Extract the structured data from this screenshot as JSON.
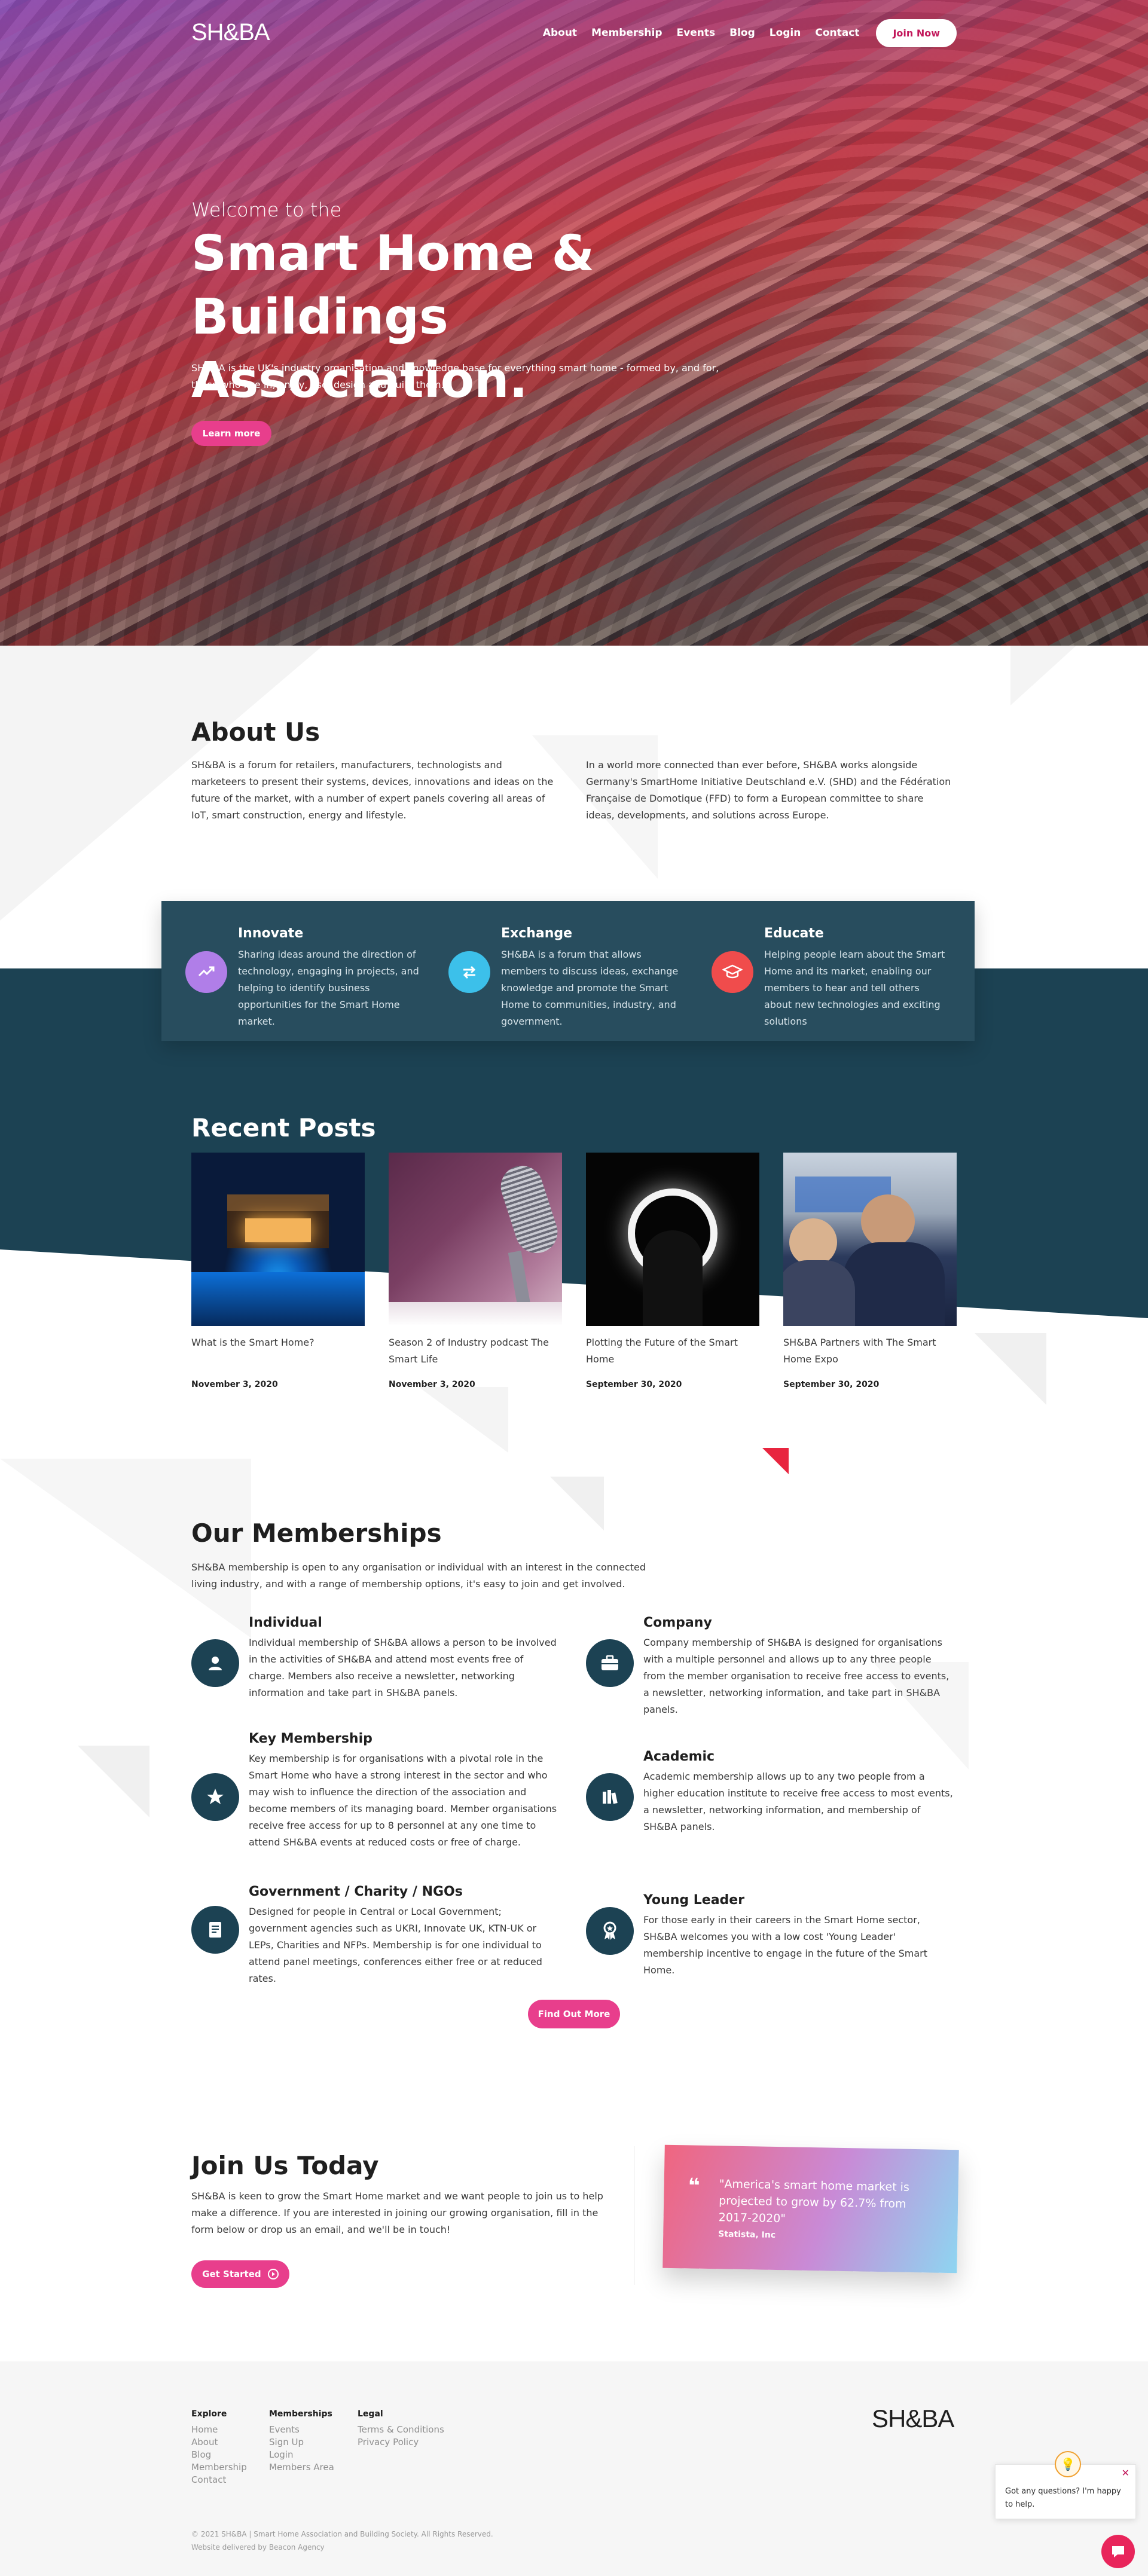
{
  "brand": {
    "logo": "SH&BA"
  },
  "nav": {
    "items": [
      "About",
      "Membership",
      "Events",
      "Blog",
      "Login",
      "Contact"
    ],
    "cta": "Join Now"
  },
  "hero": {
    "welcome": "Welcome to the",
    "title": "Smart Home & Buildings Association.",
    "description": "SH&BA is the UK's industry organisation and knowledge base for everything smart home - formed by, and for, those who live in, enjoy, use, design and build them.",
    "button": "Learn more"
  },
  "about": {
    "title": "About Us",
    "left": "SH&BA is a forum for retailers, manufacturers, technologists and marketeers to present their systems, devices, innovations and ideas on the future of the market, with a number of expert panels covering all areas of IoT, smart construction, energy and lifestyle.",
    "right": "In a world more connected than ever before, SH&BA works alongside Germany's SmartHome Initiative Deutschland e.V. (SHD) and the Fédération Française de Domotique (FFD) to form a European committee to share ideas, developments, and solutions across Europe."
  },
  "features": [
    {
      "title": "Innovate",
      "text": "Sharing ideas around the direction of technology, engaging in projects, and helping to identify business opportunities for the Smart Home market.",
      "icon": "trending-up-icon",
      "color": "#b07ee8"
    },
    {
      "title": "Exchange",
      "text": "SH&BA is a forum that allows members to discuss ideas, exchange knowledge and promote the Smart Home to communities, industry, and government.",
      "icon": "exchange-arrows-icon",
      "color": "#3cc0ea"
    },
    {
      "title": "Educate",
      "text": "Helping people learn about the Smart Home and its market, enabling our members to hear and tell others about new technologies and exciting solutions",
      "icon": "graduation-cap-icon",
      "color": "#f04c4c"
    }
  ],
  "posts": {
    "title": "Recent Posts",
    "items": [
      {
        "title": "What is the Smart Home?",
        "date": "November 3, 2020"
      },
      {
        "title": "Season 2 of Industry podcast The Smart Life",
        "date": "November 3, 2020"
      },
      {
        "title": "Plotting the Future of the Smart Home",
        "date": "September 30, 2020"
      },
      {
        "title": "SH&BA Partners with The Smart Home Expo",
        "date": "September 30, 2020"
      }
    ]
  },
  "memberships": {
    "title": "Our Memberships",
    "intro": "SH&BA membership is open to any organisation or individual with an interest in the connected living industry, and with a range of membership options, it's easy to join and get involved.",
    "items": [
      {
        "title": "Individual",
        "text": "Individual membership of SH&BA allows a person to be involved in the activities of SH&BA and attend most events free of charge. Members also receive a newsletter, networking information and take part in SH&BA panels.",
        "icon": "user-icon"
      },
      {
        "title": "Company",
        "text": "Company membership of SH&BA is designed for organisations with a multiple personnel and allows up to any three people from the member organisation to receive free access to events, a newsletter, networking information, and take part in SH&BA panels.",
        "icon": "briefcase-icon"
      },
      {
        "title": "Key Membership",
        "text": "Key membership is for organisations with a pivotal role in the Smart Home who have a strong interest in the sector and who may wish to influence the direction of the association and become members of its managing board. Member organisations receive free access for up to 8 personnel at any one time to attend SH&BA events at reduced costs or free of charge.",
        "icon": "star-hand-icon"
      },
      {
        "title": "Academic",
        "text": "Academic membership allows up to any two people from a higher education institute to receive free access to most events, a newsletter, networking information, and membership of SH&BA panels.",
        "icon": "books-icon"
      },
      {
        "title": "Government / Charity / NGOs",
        "text": "Designed for people in Central or Local Government; government agencies such as UKRI, Innovate UK, KTN-UK or LEPs, Charities and NFPs. Membership is for one individual to attend panel meetings, conferences either free or at reduced rates.",
        "icon": "document-icon"
      },
      {
        "title": "Young Leader",
        "text": "For those early in their careers in the Smart Home sector, SH&BA welcomes you with a low cost 'Young Leader' membership incentive to engage in the future of the Smart Home.",
        "icon": "award-icon"
      }
    ],
    "button": "Find Out More"
  },
  "join": {
    "title": "Join Us Today",
    "text": "SH&BA is keen to grow the Smart Home market and we want people to join us to help make a difference. If you are interested in joining our growing organisation, fill in the form below or drop us an email, and we'll be in touch!",
    "button": "Get Started",
    "quote": "\"America's smart home market is projected to grow by 62.7% from 2017-2020\"",
    "quote_source": "Statista, Inc"
  },
  "footer": {
    "columns": [
      {
        "title": "Explore",
        "links": [
          "Home",
          "About",
          "Blog",
          "Membership",
          "Contact"
        ]
      },
      {
        "title": "Memberships",
        "links": [
          "Events",
          "Sign Up",
          "Login",
          "Members Area"
        ]
      },
      {
        "title": "Legal",
        "links": [
          "Terms & Conditions",
          "Privacy Policy"
        ]
      }
    ],
    "copyright": "© 2021 SH&BA | Smart Home Association and Building Society. All Rights Reserved.",
    "credit": "Website delivered by Beacon Agency"
  },
  "chat": {
    "message": "Got any questions? I'm happy to help."
  },
  "colors": {
    "accent": "#e83e8c",
    "dark": "#1c4253",
    "card": "#284d5e"
  }
}
